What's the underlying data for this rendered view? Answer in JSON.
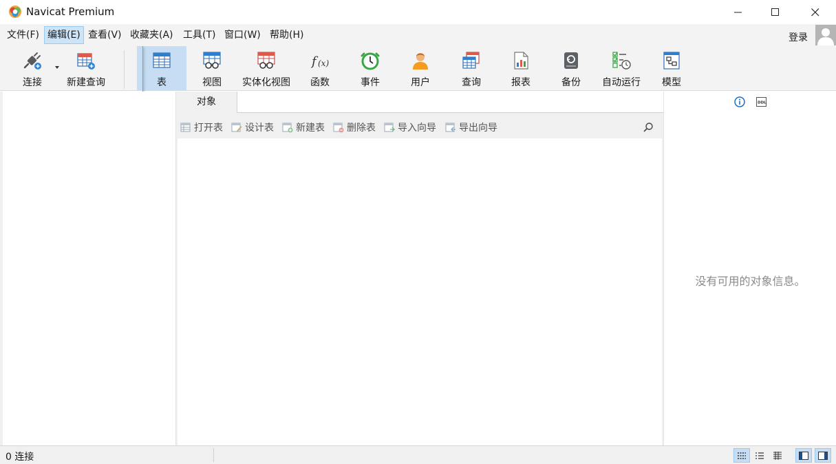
{
  "window": {
    "title": "Navicat Premium"
  },
  "menu": {
    "items": [
      "文件(F)",
      "编辑(E)",
      "查看(V)",
      "收藏夹(A)",
      "工具(T)",
      "窗口(W)",
      "帮助(H)"
    ],
    "active_index": 1,
    "login": "登录"
  },
  "toolbar": {
    "connect": "连接",
    "new_query": "新建查询",
    "table": "表",
    "view": "视图",
    "materialized_view": "实体化视图",
    "function": "函数",
    "event": "事件",
    "user": "用户",
    "query": "查询",
    "report": "报表",
    "backup": "备份",
    "automation": "自动运行",
    "model": "模型",
    "active": "table"
  },
  "objects": {
    "tab": "对象",
    "open_table": "打开表",
    "design_table": "设计表",
    "new_table": "新建表",
    "delete_table": "删除表",
    "import_wizard": "导入向导",
    "export_wizard": "导出向导"
  },
  "info": {
    "empty_message": "没有可用的对象信息。"
  },
  "status": {
    "connections": "0 连接"
  },
  "colors": {
    "active_highlight": "#c6ddf3",
    "menu_active": "#cce4f7",
    "toolbar_bg": "#f3f3f3"
  }
}
